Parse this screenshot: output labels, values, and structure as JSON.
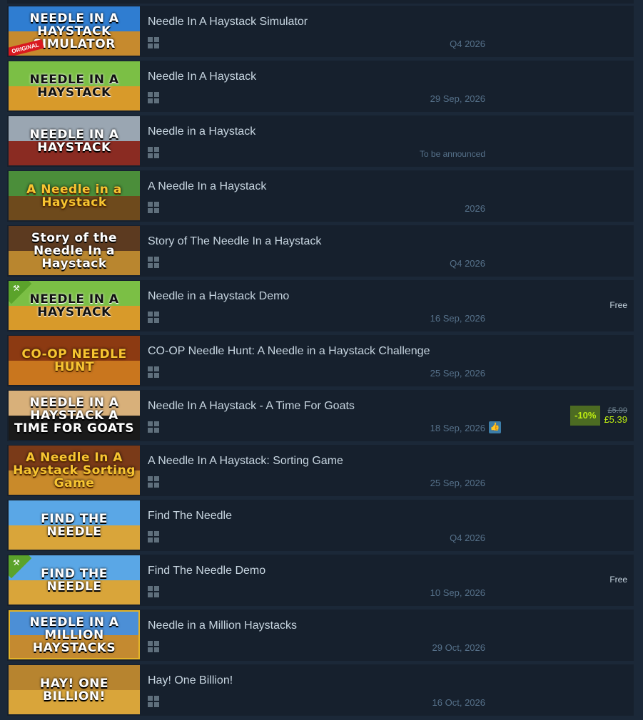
{
  "results": [
    {
      "title": "Needle In A Haystack Simulator",
      "date": "Q4 2026",
      "os": "windows-icon",
      "capsule": {
        "art_text": "NEEDLE IN A HAYSTACK SIMULATOR",
        "badge": "ORIGINAL",
        "sky": "#2f7dd1",
        "hay": "#c68a2e",
        "text_style": "white"
      }
    },
    {
      "title": "Needle In A Haystack",
      "date": "29 Sep, 2026",
      "os": "windows-icon",
      "capsule": {
        "art_text": "NEEDLE IN A HAYSTACK",
        "sky": "#7bbf45",
        "hay": "#d89a2a",
        "text_style": "dark"
      }
    },
    {
      "title": "Needle in a Haystack",
      "date": "To be announced",
      "os": "windows-icon",
      "capsule": {
        "art_text": "NEEDLE IN A HAYSTACK",
        "sky": "#9aa6b2",
        "hay": "#8a2b22",
        "text_style": "white"
      }
    },
    {
      "title": "A Needle In a Haystack",
      "date": "2026",
      "os": "windows-icon",
      "capsule": {
        "art_text": "A Needle in a Haystack",
        "sky": "#4b8e3a",
        "hay": "#6e4a1c",
        "text_style": "gold"
      }
    },
    {
      "title": "Story of The Needle In a Haystack",
      "date": "Q4 2026",
      "os": "windows-icon",
      "capsule": {
        "art_text": "Story of the Needle In a Haystack",
        "sky": "#5c3a20",
        "hay": "#b9862f",
        "text_style": "white"
      }
    },
    {
      "title": "Needle in a Haystack Demo",
      "date": "16 Sep, 2026",
      "os": "windows-icon",
      "price": "Free",
      "capsule": {
        "art_text": "NEEDLE IN A HAYSTACK",
        "badge": "demo",
        "sky": "#7bbf45",
        "hay": "#d89a2a",
        "text_style": "dark"
      }
    },
    {
      "title": "CO-OP Needle Hunt: A Needle in a Haystack Challenge",
      "date": "25 Sep, 2026",
      "os": "windows-icon",
      "capsule": {
        "art_text": "CO-OP NEEDLE HUNT",
        "sky": "#8c3a12",
        "hay": "#c9761e",
        "text_style": "gold"
      }
    },
    {
      "title": "Needle In A Haystack - A Time For Goats",
      "date": "18 Sep, 2026",
      "os": "windows-icon",
      "review_icon": "thumbs-up-icon",
      "discount": {
        "percent": "-10%",
        "original": "£5.99",
        "final": "£5.39"
      },
      "capsule": {
        "art_text": "NEEDLE IN A HAYSTACK A TIME FOR GOATS",
        "sky": "#d8b07a",
        "hay": "#1a1a1a",
        "text_style": "white"
      }
    },
    {
      "title": "A Needle In A Haystack: Sorting Game",
      "date": "25 Sep, 2026",
      "os": "windows-icon",
      "capsule": {
        "art_text": "A Needle In A Haystack Sorting Game",
        "sky": "#7a3a18",
        "hay": "#c98a2a",
        "text_style": "gold"
      }
    },
    {
      "title": "Find The Needle",
      "date": "Q4 2026",
      "os": "windows-icon",
      "capsule": {
        "art_text": "FIND THE NEEDLE",
        "sky": "#5aa7e6",
        "hay": "#d9a53a",
        "text_style": "white"
      }
    },
    {
      "title": "Find The Needle Demo",
      "date": "10 Sep, 2026",
      "os": "windows-icon",
      "price": "Free",
      "capsule": {
        "art_text": "FIND THE NEEDLE",
        "badge": "demo",
        "sky": "#5aa7e6",
        "hay": "#d9a53a",
        "text_style": "white"
      }
    },
    {
      "title": "Needle in a Million Haystacks",
      "date": "29 Oct, 2026",
      "os": "windows-icon",
      "capsule": {
        "art_text": "NEEDLE IN A MILLION HAYSTACKS",
        "sky": "#4c8fd6",
        "hay": "#c48a30",
        "text_style": "white",
        "border": "gold"
      }
    },
    {
      "title": "Hay! One Billion!",
      "date": "16 Oct, 2026",
      "os": "windows-icon",
      "capsule": {
        "art_text": "HAY! ONE BILLION!",
        "sky": "#b7842f",
        "hay": "#d9a53a",
        "text_style": "white"
      }
    }
  ]
}
